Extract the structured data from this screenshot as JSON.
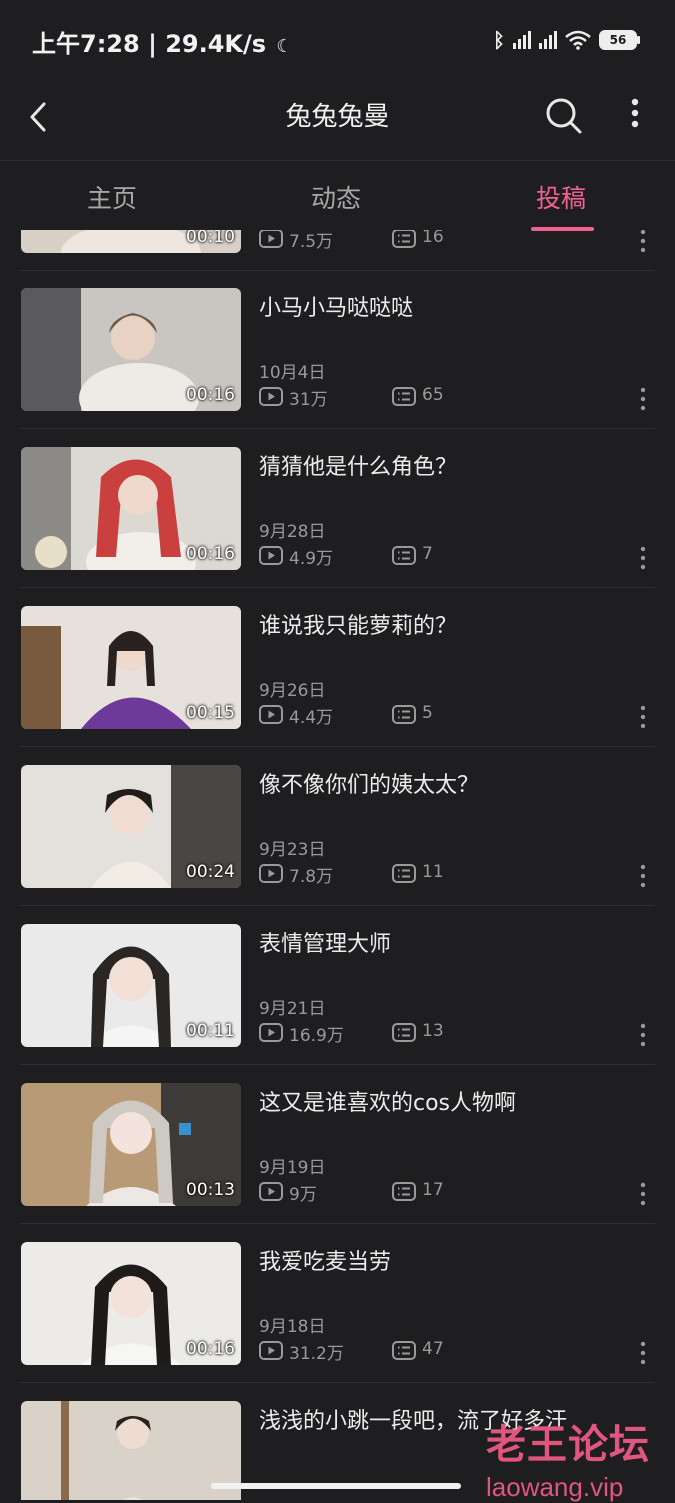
{
  "status_bar": {
    "time": "上午7:28",
    "speed": "29.4K/s",
    "battery": "56"
  },
  "header": {
    "title": "兔兔兔曼"
  },
  "tabs": [
    {
      "label": "主页"
    },
    {
      "label": "动态"
    },
    {
      "label": "投稿"
    }
  ],
  "partial_item": {
    "duration": "00:10",
    "views": "7.5万",
    "danmaku": "16"
  },
  "videos": [
    {
      "title": "小马小马哒哒哒",
      "date": "10月4日",
      "views": "31万",
      "danmaku": "65",
      "duration": "00:16"
    },
    {
      "title": "猜猜他是什么角色？",
      "date": "9月28日",
      "views": "4.9万",
      "danmaku": "7",
      "duration": "00:16"
    },
    {
      "title": "谁说我只能萝莉的？",
      "date": "9月26日",
      "views": "4.4万",
      "danmaku": "5",
      "duration": "00:15"
    },
    {
      "title": "像不像你们的姨太太？",
      "date": "9月23日",
      "views": "7.8万",
      "danmaku": "11",
      "duration": "00:24"
    },
    {
      "title": "表情管理大师",
      "date": "9月21日",
      "views": "16.9万",
      "danmaku": "13",
      "duration": "00:11"
    },
    {
      "title": "这又是谁喜欢的cos人物啊",
      "date": "9月19日",
      "views": "9万",
      "danmaku": "17",
      "duration": "00:13"
    },
    {
      "title": "我爱吃麦当劳",
      "date": "9月18日",
      "views": "31.2万",
      "danmaku": "47",
      "duration": "00:16"
    },
    {
      "title": "浅浅的小跳一段吧，流了好多汗",
      "date": "",
      "views": "",
      "danmaku": "",
      "duration": ""
    }
  ],
  "watermark": {
    "name": "老王论坛",
    "url": "laowang.vip"
  },
  "colors": {
    "accent": "#f06292",
    "background": "#1e1e20",
    "watermark": "#e0567f"
  },
  "icons": [
    "back-icon",
    "search-icon",
    "more-icon",
    "play-count-icon",
    "danmaku-icon",
    "item-more-icon"
  ]
}
